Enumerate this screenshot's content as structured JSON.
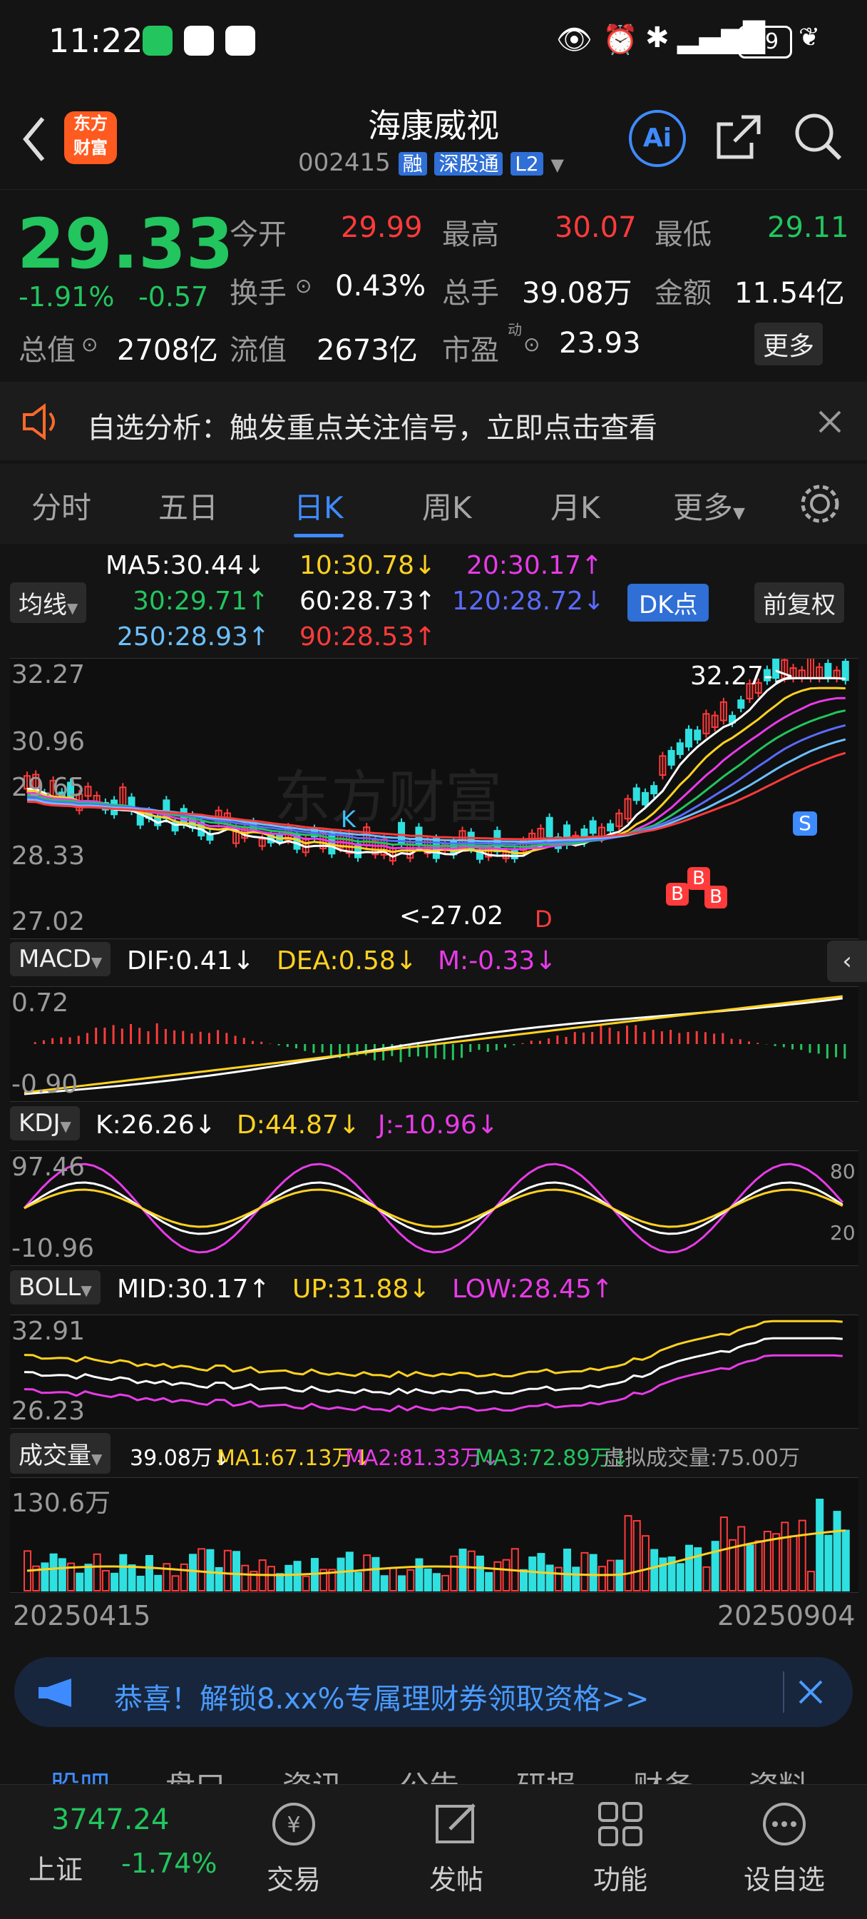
{
  "status": {
    "time": "11:22",
    "battery": "89"
  },
  "stock": {
    "name": "海康威视",
    "code": "002415",
    "tags": [
      "融",
      "深股通",
      "L2"
    ],
    "logo": [
      "东方",
      "财富"
    ]
  },
  "quote": {
    "price": "29.33",
    "change_pct": "-1.91%",
    "change": "-0.57",
    "open_label": "今开",
    "open": "29.99",
    "high_label": "最高",
    "high": "30.07",
    "low_label": "最低",
    "low": "29.11",
    "turnover_label": "换手",
    "turnover": "0.43%",
    "volume_label": "总手",
    "volume": "39.08万",
    "amount_label": "金额",
    "amount": "11.54亿",
    "mktcap_label": "总值",
    "mktcap": "2708亿",
    "float_label": "流值",
    "float": "2673亿",
    "pe_label": "市盈",
    "pe_sup": "动",
    "pe": "23.93",
    "more": "更多"
  },
  "notice": {
    "text": "自选分析：触发重点关注信号，立即点击查看"
  },
  "tabs": [
    {
      "label": "分时",
      "active": false
    },
    {
      "label": "五日",
      "active": false
    },
    {
      "label": "日K",
      "active": true
    },
    {
      "label": "周K",
      "active": false
    },
    {
      "label": "月K",
      "active": false
    },
    {
      "label": "更多",
      "active": false
    }
  ],
  "ma": {
    "selector": "均线",
    "ma5": "MA5:30.44↓",
    "ma10": "10:30.78↓",
    "ma20": "20:30.17↑",
    "ma30": "30:29.71↑",
    "ma60": "60:28.73↑",
    "ma120": "120:28.72↓",
    "ma250": "250:28.93↑",
    "ma90": "90:28.53↑",
    "dk": "DK点",
    "adjust": "前复权"
  },
  "kline": {
    "axis": [
      "32.27",
      "30.96",
      "29.65",
      "28.33",
      "27.02"
    ],
    "high_marker": "32.27->",
    "low_marker": "<-27.02",
    "watermark": "东方财富",
    "signals": {
      "s": "S",
      "d": "D",
      "k": "K",
      "b": "B"
    }
  },
  "macd": {
    "name": "MACD",
    "dif": "DIF:0.41↓",
    "dea": "DEA:0.58↓",
    "m": "M:-0.33↓",
    "axis_top": "0.72",
    "axis_bottom": "-0.90"
  },
  "kdj": {
    "name": "KDJ",
    "k": "K:26.26↓",
    "d": "D:44.87↓",
    "j": "J:-10.96↓",
    "axis_top": "97.46",
    "axis_bottom": "-10.96",
    "right_80": "80",
    "right_20": "20"
  },
  "boll": {
    "name": "BOLL",
    "mid": "MID:30.17↑",
    "up": "UP:31.88↓",
    "low": "LOW:28.45↑",
    "axis_top": "32.91",
    "axis_bottom": "26.23"
  },
  "volume": {
    "name": "成交量",
    "vol": "39.08万↓",
    "ma1": "MA1:67.13万↓",
    "ma2": "MA2:81.33万↓",
    "ma3": "MA3:72.89万↓",
    "virtual": "虚拟成交量:75.00万",
    "axis_top": "130.6万"
  },
  "dates": {
    "start": "20250415",
    "end": "20250904"
  },
  "promo": {
    "text": "恭喜！解锁8.xx%专属理财券领取资格>>"
  },
  "subtabs": [
    "股吧",
    "盘口",
    "资讯",
    "公告",
    "研报",
    "财务",
    "资料"
  ],
  "index": {
    "value": "3747.24",
    "name": "上证",
    "change": "-1.74%"
  },
  "nav": [
    "交易",
    "发帖",
    "功能",
    "设自选"
  ],
  "colors": {
    "up": "#ff3b3b",
    "down": "#22c55e",
    "accent": "#3e8bff",
    "yellow": "#ffd21f",
    "magenta": "#e83be8"
  }
}
